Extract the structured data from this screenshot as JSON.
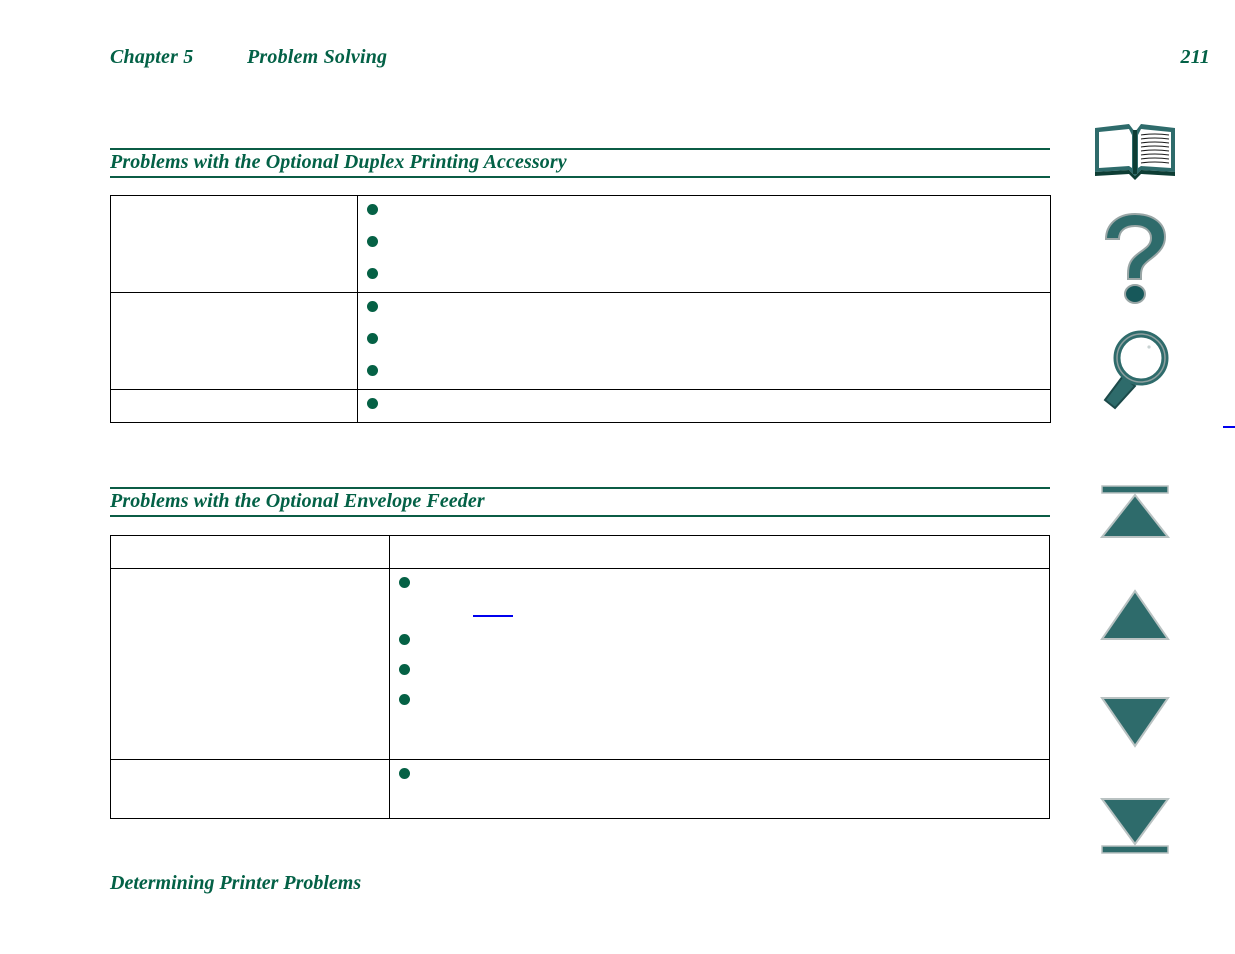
{
  "header": {
    "chapter": "Chapter 5",
    "title": "Problem Solving",
    "page_number": "211"
  },
  "colors": {
    "heading_green": "#036146",
    "rule_green": "#0b5c45",
    "bullet_green": "#056145",
    "link_blue": "#0000ee",
    "icon_teal": "#2e6b6b",
    "icon_dark_green": "#0d5a4c",
    "table_border": "#000000",
    "page_background": "#ffffff"
  },
  "sections": [
    {
      "id": "duplex",
      "heading": "Problems with the Optional Duplex Printing Accessory",
      "table": {
        "has_header_row": false,
        "columns": [
          "",
          ""
        ],
        "rows": [
          {
            "symptom": "",
            "causes": [
              "",
              "",
              ""
            ],
            "link": null
          },
          {
            "symptom": "",
            "causes": [
              "",
              "",
              ""
            ],
            "link": null
          },
          {
            "symptom": "",
            "causes": [
              ""
            ],
            "link": ""
          }
        ]
      }
    },
    {
      "id": "envelope",
      "heading": "Problems with the Optional Envelope Feeder",
      "table": {
        "has_header_row": true,
        "columns": [
          "",
          ""
        ],
        "rows": [
          {
            "symptom": "",
            "causes": [
              "",
              "",
              "",
              ""
            ],
            "link": ""
          },
          {
            "symptom": "",
            "causes": [
              ""
            ],
            "link": null
          }
        ]
      }
    }
  ],
  "footer_heading": "Determining Printer Problems",
  "nav_sidebar": {
    "items": [
      {
        "name": "book-icon",
        "label": "Table of Contents"
      },
      {
        "name": "question-mark-icon",
        "label": "Help"
      },
      {
        "name": "magnifier-icon",
        "label": "Search"
      },
      {
        "name": "first-page-icon",
        "label": "First Page"
      },
      {
        "name": "previous-page-icon",
        "label": "Previous Page"
      },
      {
        "name": "next-page-icon",
        "label": "Next Page"
      },
      {
        "name": "last-page-icon",
        "label": "Last Page"
      }
    ]
  }
}
